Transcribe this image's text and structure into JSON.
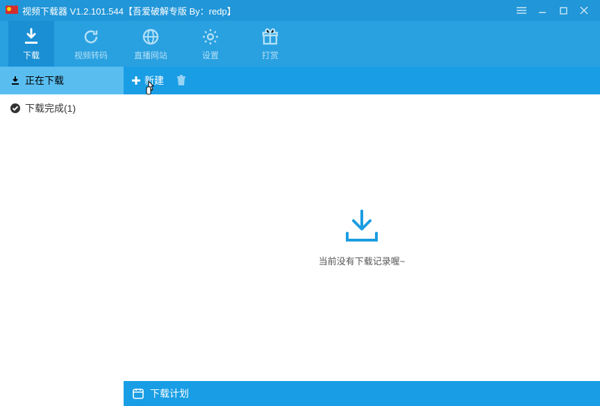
{
  "title": "视频下载器 V1.2.101.544【吾爱破解专版 By：redp】",
  "toolbar": [
    {
      "label": "下载",
      "icon": "download",
      "active": true
    },
    {
      "label": "视频转码",
      "icon": "refresh",
      "active": false
    },
    {
      "label": "直播网站",
      "icon": "globe",
      "active": false
    },
    {
      "label": "设置",
      "icon": "gear",
      "active": false
    },
    {
      "label": "打赏",
      "icon": "gift",
      "active": false
    }
  ],
  "sidebar": [
    {
      "label": "正在下载",
      "icon": "downloading",
      "active": true
    },
    {
      "label": "下载完成(1)",
      "icon": "check",
      "active": false
    }
  ],
  "contentHeader": {
    "newLabel": "新建",
    "deleteIcon": "trash"
  },
  "emptyText": "当前没有下载记录喔~",
  "footer": {
    "label": "下载计划",
    "icon": "calendar"
  }
}
